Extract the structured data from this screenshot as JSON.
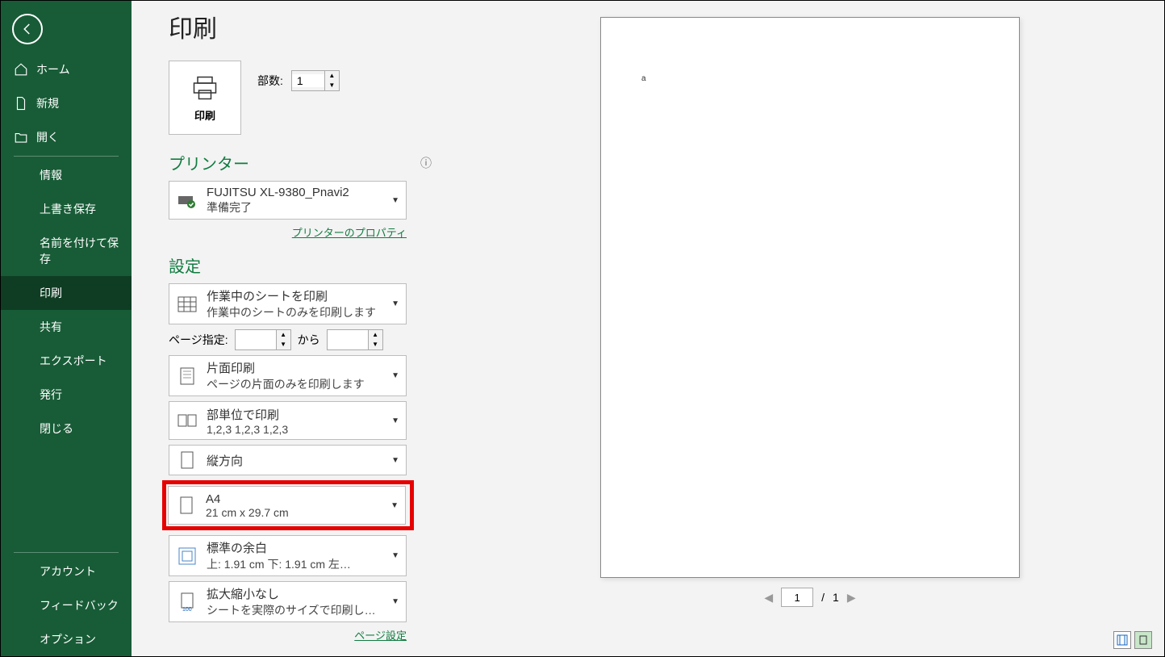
{
  "sidebar": {
    "home": "ホーム",
    "new": "新規",
    "open": "開く",
    "info": "情報",
    "save": "上書き保存",
    "saveas": "名前を付けて保存",
    "print": "印刷",
    "share": "共有",
    "export": "エクスポート",
    "publish": "発行",
    "close": "閉じる",
    "account": "アカウント",
    "feedback": "フィードバック",
    "options": "オプション"
  },
  "page": {
    "title": "印刷",
    "print_button": "印刷",
    "copies_label": "部数:",
    "copies_value": "1"
  },
  "printer": {
    "heading": "プリンター",
    "name": "FUJITSU XL-9380_Pnavi2",
    "status": "準備完了",
    "properties_link": "プリンターのプロパティ"
  },
  "settings": {
    "heading": "設定",
    "sheets_title": "作業中のシートを印刷",
    "sheets_sub": "作業中のシートのみを印刷します",
    "pagespec_label": "ページ指定:",
    "pagespec_from": "",
    "pagespec_to_label": "から",
    "pagespec_to": "",
    "sides_title": "片面印刷",
    "sides_sub": "ページの片面のみを印刷します",
    "collate_title": "部単位で印刷",
    "collate_sub": "1,2,3    1,2,3    1,2,3",
    "orientation": "縦方向",
    "paper_title": "A4",
    "paper_sub": "21 cm x 29.7 cm",
    "margins_title": "標準の余白",
    "margins_sub": "上: 1.91 cm 下: 1.91 cm 左…",
    "scale_title": "拡大縮小なし",
    "scale_sub": "シートを実際のサイズで印刷します",
    "page_setup_link": "ページ設定"
  },
  "preview": {
    "cell": "a",
    "page_current": "1",
    "page_sep": "/",
    "page_total": "1"
  }
}
